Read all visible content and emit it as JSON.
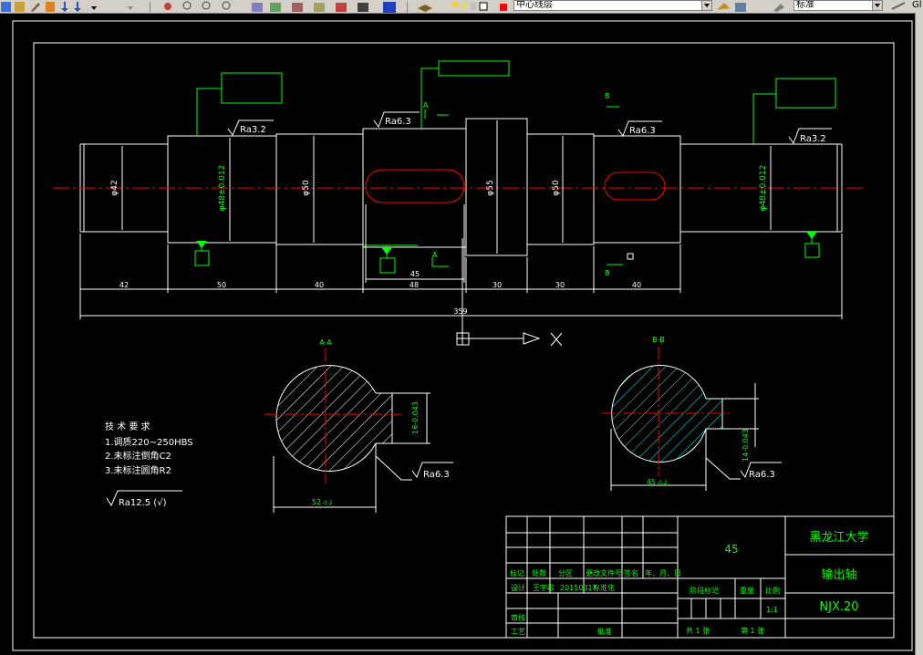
{
  "toolbar": {
    "layer_combo": "中心线层",
    "style_combo": "标准",
    "right_clip": "Gl"
  },
  "main_view": {
    "roughness": [
      "Ra3.2",
      "Ra3.2",
      "Ra6.3",
      "Ra6.3"
    ],
    "diameters": [
      "φ42",
      "φ48±0.012",
      "φ50",
      "φ55",
      "φ50",
      "φ48±0.012"
    ],
    "section_markers": [
      "A",
      "A",
      "B",
      "B"
    ],
    "lengths": [
      "42",
      "50",
      "40",
      "48",
      "30",
      "30",
      "40"
    ],
    "keyway_dim": "45",
    "total_length": "359"
  },
  "section_a": {
    "label": "A-A",
    "roughness": "Ra6.3",
    "width_dim": "52",
    "width_tol": "-0.2",
    "key_dim": "16-0.043"
  },
  "section_b": {
    "label": "B-B",
    "roughness": "Ra6.3",
    "width_dim": "45",
    "width_tol": "-0.2",
    "key_dim": "14-0.043"
  },
  "tech_notes": {
    "title": "技 术 要 求",
    "lines": [
      "1.调质220~250HBS",
      "2.未标注倒角C2",
      "3.未标注圆角R2"
    ],
    "general_roughness": "Ra12.5 (√)"
  },
  "title_block": {
    "material": "45",
    "school": "黑龙江大学",
    "part_name": "输出轴",
    "drawing_no": "NJX.20",
    "row_headers": [
      "标记",
      "处数",
      "分区",
      "更改文件号",
      "签名",
      "年、月、日"
    ],
    "design_label": "设计",
    "designer": "王宇歌",
    "date": "20150317",
    "std_label": "标准化",
    "review_label": "审核",
    "process_label": "工艺",
    "approve_label": "批准",
    "stage_label": "阶段标记",
    "weight_label": "重量",
    "scale_label": "比例",
    "scale": "1:1",
    "sheet_total": "共 1 张",
    "sheet_no": "第 1 张"
  },
  "colors": {
    "background": "#000000",
    "outline": "#ffffff",
    "centerline": "#ff0000",
    "annotation": "#00ff00",
    "hatch": "#00ffff",
    "title_text": "#00ff00"
  }
}
